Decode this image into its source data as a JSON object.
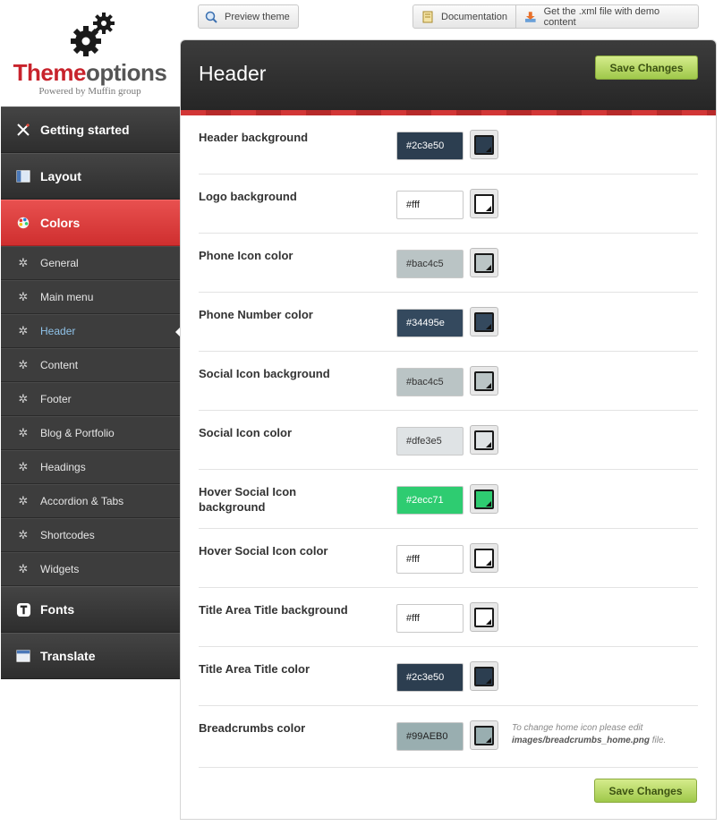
{
  "logo": {
    "brand_red": "Theme",
    "brand_grey": "options",
    "tagline": "Powered by Muffin group"
  },
  "toolbar": {
    "preview": "Preview theme",
    "docs": "Documentation",
    "demo": "Get the .xml file with demo content"
  },
  "sidebar": {
    "main_top": [
      {
        "label": "Getting started",
        "icon": "tools-icon"
      },
      {
        "label": "Layout",
        "icon": "layout-icon"
      },
      {
        "label": "Colors",
        "icon": "palette-icon"
      }
    ],
    "sub": [
      {
        "label": "General"
      },
      {
        "label": "Main menu"
      },
      {
        "label": "Header"
      },
      {
        "label": "Content"
      },
      {
        "label": "Footer"
      },
      {
        "label": "Blog & Portfolio"
      },
      {
        "label": "Headings"
      },
      {
        "label": "Accordion & Tabs"
      },
      {
        "label": "Shortcodes"
      },
      {
        "label": "Widgets"
      }
    ],
    "main_bottom": [
      {
        "label": "Fonts",
        "icon": "text-icon"
      },
      {
        "label": "Translate",
        "icon": "window-icon"
      }
    ]
  },
  "panel": {
    "title": "Header",
    "save_label": "Save Changes"
  },
  "fields": [
    {
      "label": "Header background",
      "value": "#2c3e50",
      "color": "#2c3e50",
      "text_color": "#ffffff"
    },
    {
      "label": "Logo background",
      "value": "#fff",
      "color": "#ffffff",
      "text_color": "#222222"
    },
    {
      "label": "Phone Icon color",
      "value": "#bac4c5",
      "color": "#bac4c5",
      "text_color": "#333333"
    },
    {
      "label": "Phone Number color",
      "value": "#34495e",
      "color": "#34495e",
      "text_color": "#ffffff"
    },
    {
      "label": "Social Icon background",
      "value": "#bac4c5",
      "color": "#bac4c5",
      "text_color": "#333333"
    },
    {
      "label": "Social Icon color",
      "value": "#dfe3e5",
      "color": "#dfe3e5",
      "text_color": "#333333"
    },
    {
      "label": "Hover Social Icon background",
      "value": "#2ecc71",
      "color": "#2ecc71",
      "text_color": "#ffffff"
    },
    {
      "label": "Hover Social Icon color",
      "value": "#fff",
      "color": "#ffffff",
      "text_color": "#222222"
    },
    {
      "label": "Title Area Title background",
      "value": "#fff",
      "color": "#ffffff",
      "text_color": "#222222"
    },
    {
      "label": "Title Area Title color",
      "value": "#2c3e50",
      "color": "#2c3e50",
      "text_color": "#ffffff"
    },
    {
      "label": "Breadcrumbs color",
      "value": "#99AEB0",
      "color": "#99AEB0",
      "text_color": "#222222",
      "note_prefix": "To change home icon please edit",
      "note_path": "images/breadcrumbs_home.png",
      "note_suffix": "file."
    }
  ],
  "active_sub": "Header"
}
